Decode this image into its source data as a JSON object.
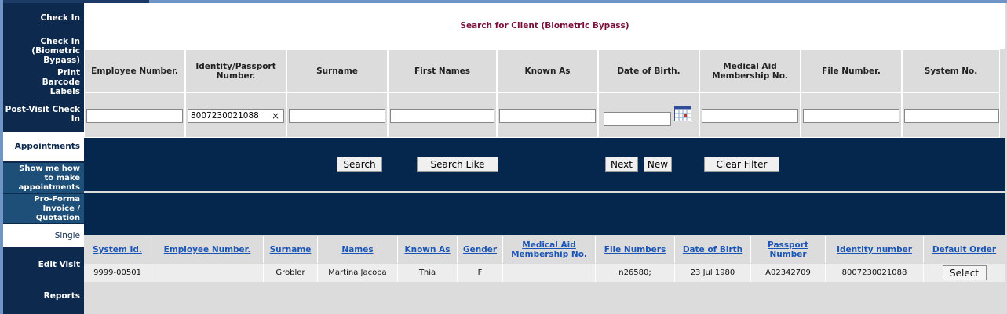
{
  "sidebar": {
    "items": [
      {
        "label": "Check In"
      },
      {
        "label": "Check In (Biometric Bypass)"
      },
      {
        "label": "Print Barcode Labels"
      },
      {
        "label": "Post-Visit Check In"
      },
      {
        "label": "Appointments"
      },
      {
        "label": "Show me how to make appointments"
      },
      {
        "label": "Pro-Forma Invoice / Quotation"
      },
      {
        "label": "Single"
      },
      {
        "label": "Edit Visit"
      },
      {
        "label": "Reports"
      }
    ]
  },
  "title": "Search for Client (Biometric Bypass)",
  "search_columns": [
    {
      "label": "Employee Number.",
      "value": ""
    },
    {
      "label": "Identity/Passport Number.",
      "value": "8007230021088"
    },
    {
      "label": "Surname",
      "value": ""
    },
    {
      "label": "First Names",
      "value": ""
    },
    {
      "label": "Known As",
      "value": ""
    },
    {
      "label": "Date of Birth.",
      "value": ""
    },
    {
      "label": "Medical Aid Membership No.",
      "value": ""
    },
    {
      "label": "File Number.",
      "value": ""
    },
    {
      "label": "System No.",
      "value": ""
    }
  ],
  "clear_glyph": "×",
  "buttons": {
    "search": "Search",
    "search_like": "Search Like",
    "next": "Next",
    "new": "New",
    "clear_filter": "Clear Filter"
  },
  "results": {
    "headers": [
      "System Id.",
      "Employee Number.",
      "Surname",
      "Names",
      "Known As",
      "Gender",
      "Medical Aid Membership No.",
      "File Numbers",
      "Date of Birth",
      "Passport Number",
      "Identity number",
      "Default Order"
    ],
    "rows": [
      {
        "system_id": "9999-00501",
        "employee_number": "",
        "surname": "Grobler",
        "names": "Martina Jacoba",
        "known_as": "Thia",
        "gender": "F",
        "medical_aid": "",
        "file_numbers": "n26580;",
        "dob": "23 Jul 1980",
        "passport": "A02342709",
        "identity": "8007230021088",
        "action": "Select"
      }
    ]
  },
  "colors": {
    "navy": "#0d2a4e",
    "button_bar": "#05264d",
    "title": "#7a0e3a",
    "link": "#1b55b6"
  }
}
